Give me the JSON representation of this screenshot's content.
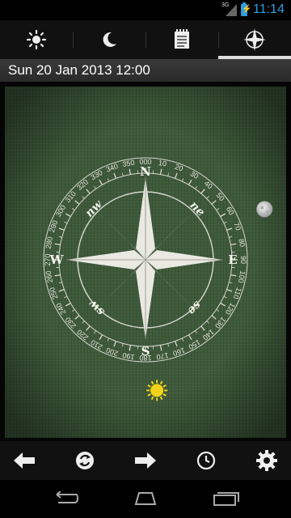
{
  "status": {
    "network": "3G",
    "time": "11:14"
  },
  "tabs": [
    {
      "name": "sun",
      "icon": "sun-icon",
      "active": false
    },
    {
      "name": "moon",
      "icon": "moon-icon",
      "active": false
    },
    {
      "name": "notes",
      "icon": "notepad-icon",
      "active": false
    },
    {
      "name": "compass",
      "icon": "compass-icon",
      "active": true
    }
  ],
  "datetime": "Sun 20 Jan 2013 12:00",
  "compass": {
    "cardinals": [
      "N",
      "E",
      "S",
      "W"
    ],
    "intercardinals": [
      "ne",
      "se",
      "sw",
      "nw"
    ],
    "degree_labels": [
      "000",
      "10",
      "20",
      "30",
      "40",
      "50",
      "60",
      "70",
      "80",
      "90",
      "100",
      "110",
      "120",
      "130",
      "140",
      "150",
      "160",
      "170",
      "180",
      "190",
      "200",
      "210",
      "220",
      "230",
      "240",
      "250",
      "260",
      "270",
      "280",
      "290",
      "300",
      "310",
      "320",
      "330",
      "340",
      "350"
    ],
    "moon_azimuth": 67,
    "sun_azimuth": 175
  },
  "colors": {
    "accent": "#2f9fe0",
    "green_background": "#3f5a3a",
    "compass_white": "#e8e8e0",
    "sun": "#f3d21a"
  },
  "toolbar": [
    {
      "name": "back",
      "icon": "arrow-left-icon"
    },
    {
      "name": "refresh",
      "icon": "refresh-icon"
    },
    {
      "name": "forward",
      "icon": "arrow-right-icon"
    },
    {
      "name": "time",
      "icon": "clock-icon"
    },
    {
      "name": "settings",
      "icon": "gear-icon"
    }
  ],
  "navigation": [
    {
      "name": "back",
      "icon": "nav-back-icon"
    },
    {
      "name": "home",
      "icon": "nav-home-icon"
    },
    {
      "name": "recent",
      "icon": "nav-recent-apps-icon"
    }
  ]
}
